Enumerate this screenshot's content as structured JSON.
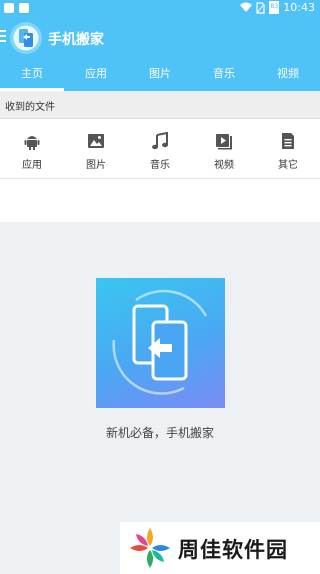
{
  "status_bar": {
    "time": "10:43",
    "battery": "83"
  },
  "app": {
    "title": "手机搬家"
  },
  "tabs": [
    {
      "label": "主页",
      "active": true
    },
    {
      "label": "应用",
      "active": false
    },
    {
      "label": "图片",
      "active": false
    },
    {
      "label": "音乐",
      "active": false
    },
    {
      "label": "视频",
      "active": false
    }
  ],
  "received": {
    "header": "收到的文件",
    "categories": [
      {
        "label": "应用",
        "icon": "android-icon"
      },
      {
        "label": "图片",
        "icon": "image-icon"
      },
      {
        "label": "音乐",
        "icon": "music-note-icon"
      },
      {
        "label": "视频",
        "icon": "video-icon"
      },
      {
        "label": "其它",
        "icon": "document-icon"
      }
    ]
  },
  "empty_state": {
    "tagline": "新机必备，手机搬家"
  },
  "watermark": {
    "text": "周佳软件园"
  },
  "colors": {
    "primary": "#4fc3f7",
    "background": "#eef1f4"
  }
}
